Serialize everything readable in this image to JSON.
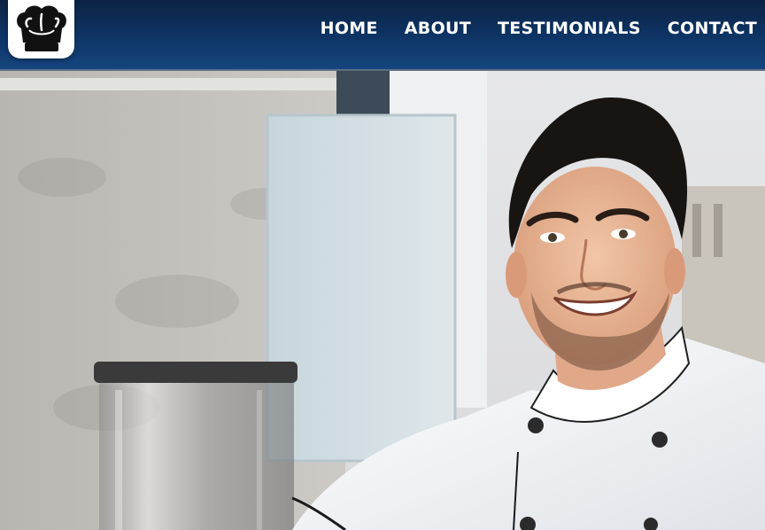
{
  "header": {
    "logo_icon": "chef-hat-icon",
    "nav": [
      {
        "label": "HOME"
      },
      {
        "label": "ABOUT"
      },
      {
        "label": "TESTIMONIALS"
      },
      {
        "label": "CONTACT"
      }
    ]
  },
  "hero": {
    "image_subject": "chef-photo"
  },
  "colors": {
    "header_dark": "#0b2344",
    "header_mid": "#15457f",
    "nav_text": "#ffffff",
    "logo_bg": "#ffffff"
  }
}
